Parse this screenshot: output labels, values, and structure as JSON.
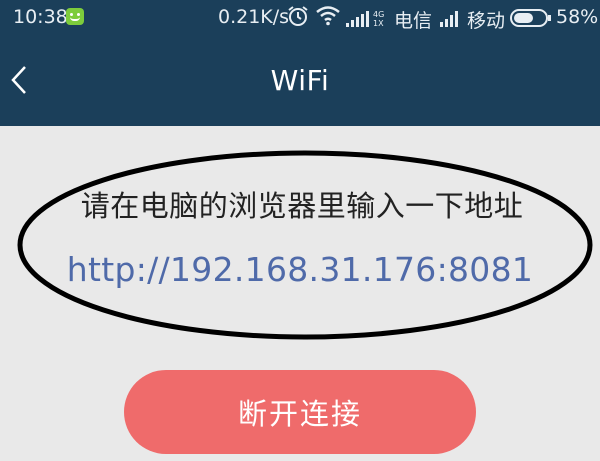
{
  "status_bar": {
    "time": "10:38",
    "app_icon": "android-app-icon",
    "net_speed": "0.21K/s",
    "alarm_icon": "alarm-clock-icon",
    "wifi_icon": "wifi-icon",
    "signal_icon": "cell-signal-4g-icon",
    "carrier_1": "电信",
    "signal_2_icon": "cell-signal-icon",
    "carrier_2": "移动",
    "battery_icon": "battery-icon",
    "battery_level": "58%"
  },
  "header": {
    "back_icon": "chevron-left-icon",
    "title": "WiFi"
  },
  "main": {
    "instruction": "请在电脑的浏览器里输入一下地址",
    "url": "http://192.168.31.176:8081",
    "disconnect_label": "断开连接"
  },
  "colors": {
    "header_bg": "#1b3f5a",
    "page_bg": "#e9e9e9",
    "url_color": "#4f6aa9",
    "button_bg": "#ef6b6b",
    "annotation_ellipse": "#000000"
  }
}
